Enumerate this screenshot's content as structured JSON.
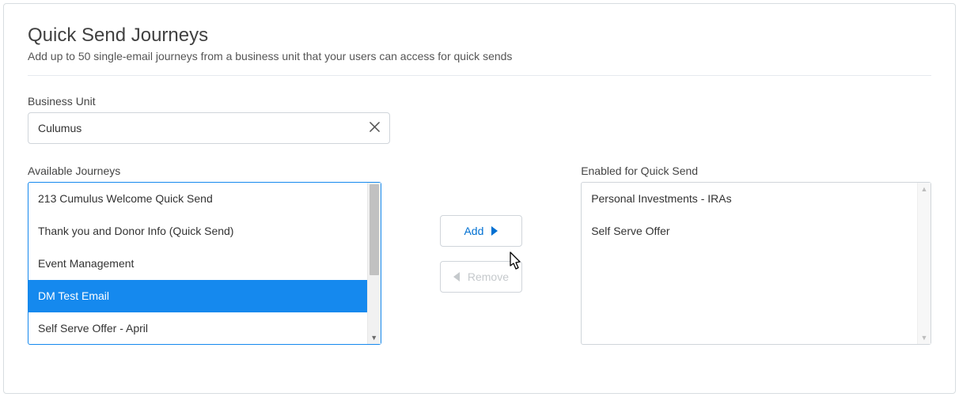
{
  "header": {
    "title": "Quick Send Journeys",
    "subtitle": "Add up to 50 single-email journeys from a business unit that your users can access for quick sends"
  },
  "businessUnit": {
    "label": "Business Unit",
    "value": "Culumus"
  },
  "available": {
    "label": "Available Journeys",
    "items": [
      "213 Cumulus Welcome Quick Send",
      "Thank you and Donor Info (Quick Send)",
      "Event Management",
      "DM Test Email",
      "Self Serve Offer - April"
    ],
    "selectedIndex": 3
  },
  "enabled": {
    "label": "Enabled for Quick Send",
    "items": [
      "Personal Investments - IRAs",
      "Self Serve Offer"
    ]
  },
  "buttons": {
    "add": "Add",
    "remove": "Remove"
  }
}
